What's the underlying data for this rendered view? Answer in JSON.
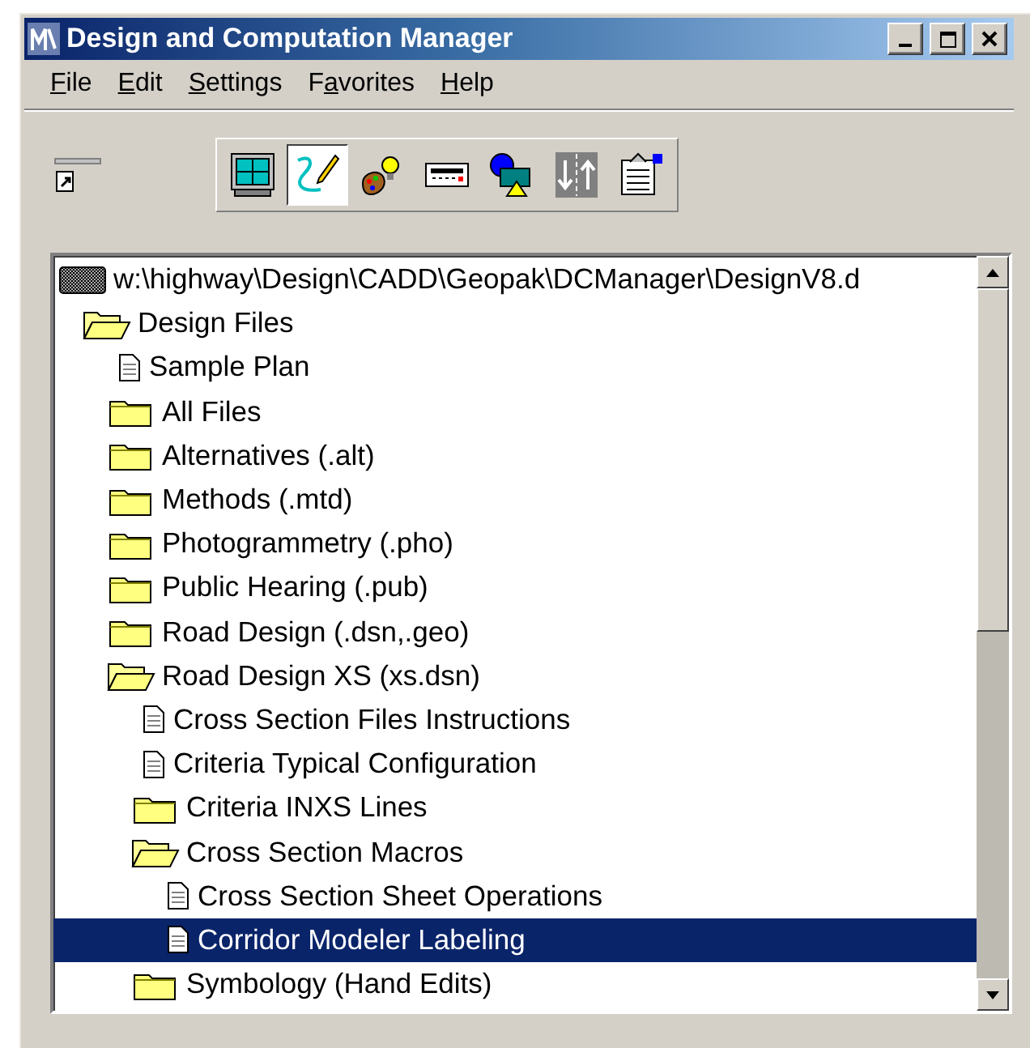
{
  "window": {
    "title": "Design and Computation Manager"
  },
  "menu": [
    {
      "key": "F",
      "post": "ile"
    },
    {
      "key": "E",
      "post": "dit"
    },
    {
      "key": "S",
      "post": "ettings"
    },
    {
      "pre": "F",
      "key": "a",
      "post": "vorites"
    },
    {
      "key": "H",
      "post": "elp"
    }
  ],
  "toolbar": {
    "buttons": [
      {
        "kind": "grid",
        "selected": false
      },
      {
        "kind": "draw",
        "selected": true
      },
      {
        "kind": "palette",
        "selected": false
      },
      {
        "kind": "calculator",
        "selected": false
      },
      {
        "kind": "shapes",
        "selected": false
      },
      {
        "kind": "road",
        "selected": false
      },
      {
        "kind": "clipboard",
        "selected": false
      }
    ]
  },
  "tree": {
    "root": {
      "label": "w:\\highway\\Design\\CADD\\Geopak\\DCManager\\DesignV8.d",
      "kind": "database",
      "children": [
        {
          "label": "Design Files",
          "kind": "folder",
          "expanded": true,
          "selected": false,
          "children": [
            {
              "label": "Sample Plan",
              "kind": "document",
              "selected": false
            },
            {
              "label": "All Files",
              "kind": "folder",
              "expanded": false,
              "selected": false
            },
            {
              "label": "Alternatives (.alt)",
              "kind": "folder",
              "expanded": false,
              "selected": false
            },
            {
              "label": "Methods (.mtd)",
              "kind": "folder",
              "expanded": false,
              "selected": false
            },
            {
              "label": "Photogrammetry (.pho)",
              "kind": "folder",
              "expanded": false,
              "selected": false
            },
            {
              "label": "Public Hearing (.pub)",
              "kind": "folder",
              "expanded": false,
              "selected": false
            },
            {
              "label": "Road Design (.dsn,.geo)",
              "kind": "folder",
              "expanded": false,
              "selected": false
            },
            {
              "label": "Road Design XS (xs.dsn)",
              "kind": "folder",
              "expanded": true,
              "selected": false,
              "children": [
                {
                  "label": "Cross Section Files Instructions",
                  "kind": "document",
                  "selected": false
                },
                {
                  "label": "Criteria Typical Configuration",
                  "kind": "document",
                  "selected": false
                },
                {
                  "label": "Criteria INXS Lines",
                  "kind": "folder",
                  "expanded": false,
                  "selected": false
                },
                {
                  "label": "Cross Section Macros",
                  "kind": "folder",
                  "expanded": true,
                  "selected": false,
                  "children": [
                    {
                      "label": "Cross Section Sheet Operations",
                      "kind": "document",
                      "selected": false
                    },
                    {
                      "label": "Corridor Modeler Labeling",
                      "kind": "document",
                      "selected": true
                    }
                  ]
                },
                {
                  "label": "Symbology (Hand Edits)",
                  "kind": "folder",
                  "expanded": false,
                  "selected": false
                }
              ]
            }
          ]
        }
      ]
    }
  }
}
